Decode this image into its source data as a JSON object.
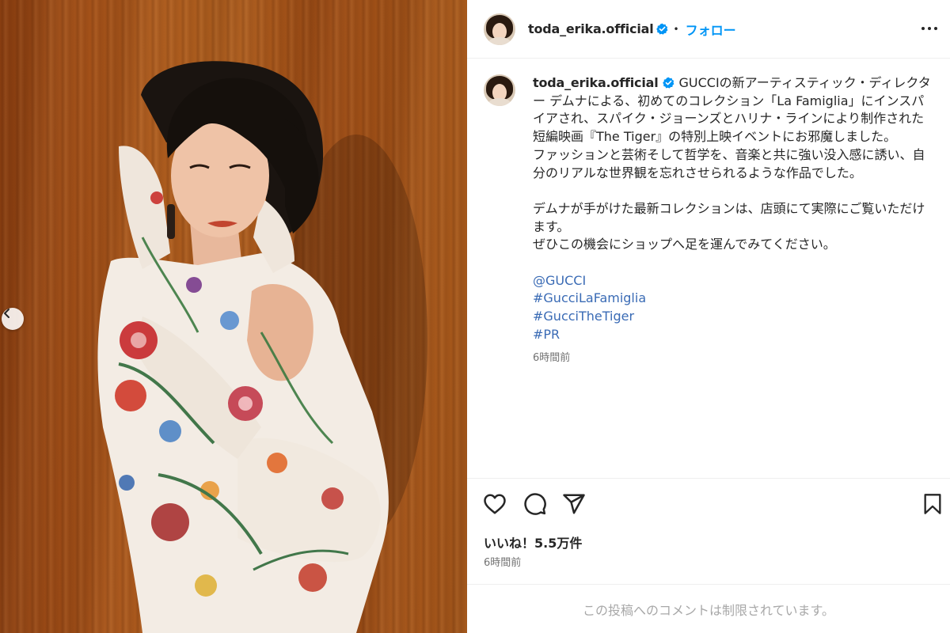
{
  "post": {
    "username": "toda_erika.official",
    "follow_label": "フォロー",
    "separator": "•",
    "caption": {
      "paragraph1": "GUCCIの新アーティスティック・ディレクター デムナによる、初めてのコレクション「La Famiglia」にインスパイアされ、スパイク・ジョーンズとハリナ・ラインにより制作された短編映画『The Tiger』の特別上映イベントにお邪魔しました。",
      "paragraph2": "ファッションと芸術そして哲学を、音楽と共に強い没入感に誘い、自分のリアルな世界観を忘れさせられるような作品でした。",
      "paragraph3": "デムナが手がけた最新コレクションは、店頭にて実際にご覧いただけます。",
      "paragraph4": "ぜひこの機会にショップへ足を運んでみてください。",
      "tags": [
        "@GUCCI",
        "#GucciLaFamiglia",
        "#GucciTheTiger",
        "#PR"
      ],
      "time": "6時間前"
    },
    "likes": "いいね！5.5万件",
    "time": "6時間前",
    "comments_disabled": "この投稿へのコメントは制限されています。"
  },
  "colors": {
    "follow": "#0095f6",
    "verified": "#0095f6",
    "tag": "#3a6bb5",
    "muted": "#737373",
    "border": "#efefef"
  },
  "icons": [
    "chevron-left-icon",
    "verified-badge-icon",
    "more-options-icon",
    "heart-icon",
    "comment-icon",
    "share-icon",
    "bookmark-icon"
  ]
}
